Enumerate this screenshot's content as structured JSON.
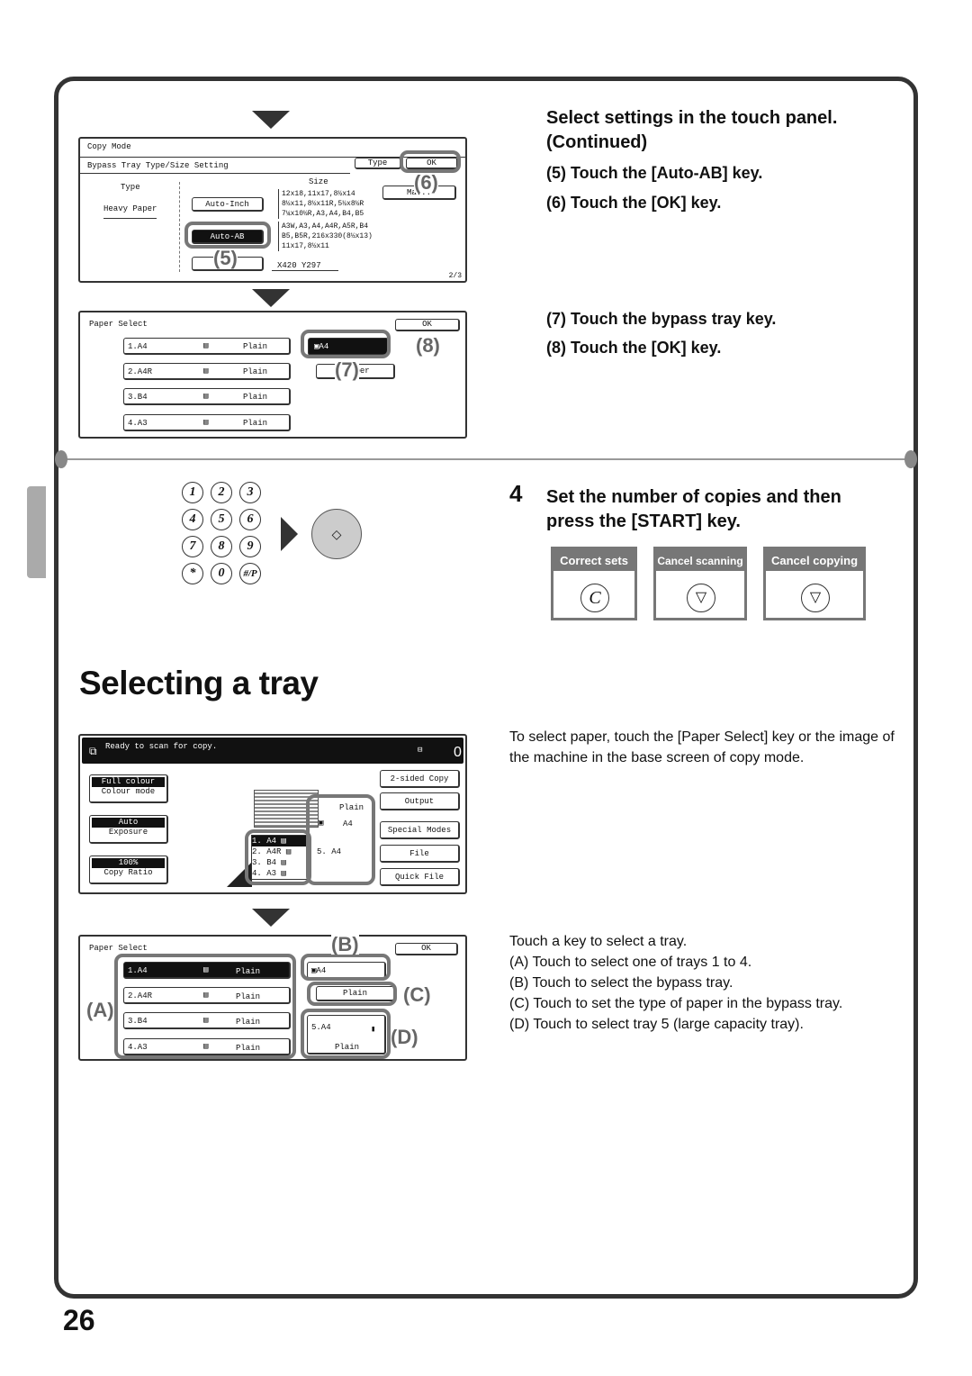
{
  "page_number": "26",
  "step3": {
    "heading": "Select settings in the touch panel. (Continued)",
    "sub5": "(5)  Touch the [Auto-AB] key.",
    "sub6": "(6)  Touch the [OK] key.",
    "sub7": "(7)  Touch the bypass tray key.",
    "sub8": "(8)  Touch the [OK] key."
  },
  "step4": {
    "number": "4",
    "heading": "Set the number of copies and then press the [START] key."
  },
  "panel1": {
    "mode": "Copy Mode",
    "title": "Bypass Tray Type/Size Setting",
    "type_btn": "Type",
    "ok": "OK",
    "type_label": "Type",
    "type_value": "Heavy Paper",
    "size_label": "Size",
    "auto_inch": "Auto-Inch",
    "auto_ab": "Auto-AB",
    "manual": "Ma...",
    "custom": "Cu        e",
    "inch_sizes": [
      "12x18,11x17,8½x14",
      "8½x11,8½x11R,5½x8½R",
      "7¼x10½R,A3,A4,B4,B5"
    ],
    "ab_sizes": [
      "A3W,A3,A4,A4R,A5R,B4",
      "B5,B5R,216x330(8½x13)",
      "11x17,8½x11"
    ],
    "custom_size": "X420 Y297",
    "page": "2/3"
  },
  "panel2": {
    "title": "Paper Select",
    "ok": "OK",
    "trays": [
      {
        "label": "1.A4",
        "type": "Plain"
      },
      {
        "label": "2.A4R",
        "type": "Plain"
      },
      {
        "label": "3.B4",
        "type": "Plain"
      },
      {
        "label": "4.A3",
        "type": "Plain"
      }
    ],
    "bypass": "A4",
    "bypass_type": "H        aper"
  },
  "callouts": {
    "c5": "(5)",
    "c6": "(6)",
    "c7": "(7)",
    "c8": "(8)",
    "A": "(A)",
    "B": "(B)",
    "C": "(C)",
    "D": "(D)"
  },
  "keypad": [
    "1",
    "2",
    "3",
    "4",
    "5",
    "6",
    "7",
    "8",
    "9",
    "*",
    "0",
    "#/P"
  ],
  "op_buttons": [
    {
      "label": "Correct sets",
      "icon": "C"
    },
    {
      "label": "Cancel scanning",
      "icon": "stop-icon"
    },
    {
      "label": "Cancel copying",
      "icon": "stop-icon"
    }
  ],
  "section_title": "Selecting a tray",
  "intro": "To select paper, touch the [Paper Select] key or the image of the machine in the base screen of copy mode.",
  "base": {
    "status": "Ready to scan for copy.",
    "count": "0",
    "colour_value": "Full colour",
    "colour_label": "Colour mode",
    "exposure_value": "Auto",
    "exposure_label": "Exposure",
    "ratio_value": "100%",
    "ratio_label": "Copy Ratio",
    "right": [
      "2-sided Copy",
      "Output",
      "Special Modes",
      "File",
      "Quick File"
    ],
    "bypass_type": "Plain",
    "bypass_size": "A4",
    "trays": [
      {
        "n": "1.",
        "s": "A4"
      },
      {
        "n": "2.",
        "s": "A4R"
      },
      {
        "n": "3.",
        "s": "B4"
      },
      {
        "n": "4.",
        "s": "A3"
      }
    ],
    "tray5": "5.  A4"
  },
  "panel4": {
    "title": "Paper Select",
    "ok": "OK",
    "trays": [
      {
        "label": "1.A4",
        "type": "Plain"
      },
      {
        "label": "2.A4R",
        "type": "Plain"
      },
      {
        "label": "3.B4",
        "type": "Plain"
      },
      {
        "label": "4.A3",
        "type": "Plain"
      }
    ],
    "bypass": "A4",
    "bypass_type": "Plain",
    "tray5": "5.A4",
    "tray5_type": "Plain"
  },
  "instructions": {
    "lead": "Touch a key to select a tray.",
    "items": [
      "(A)  Touch to select one of trays 1 to 4.",
      "(B)  Touch to select the bypass tray.",
      "(C)  Touch to set the type of paper in the bypass tray.",
      "(D)  Touch to select tray 5 (large capacity tray)."
    ]
  }
}
